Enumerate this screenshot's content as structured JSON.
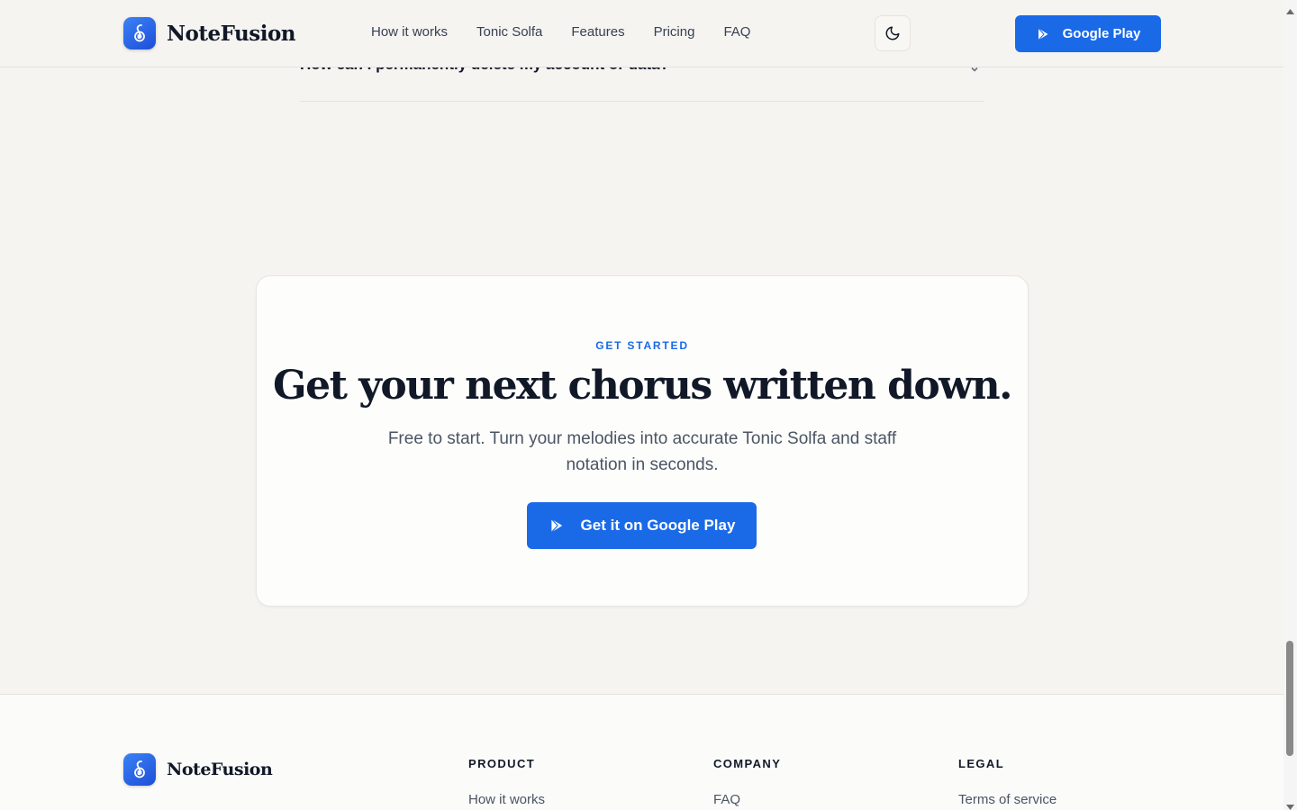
{
  "header": {
    "brand": "NoteFusion",
    "nav": [
      "How it works",
      "Tonic Solfa",
      "Features",
      "Pricing",
      "FAQ"
    ],
    "play_button": "Google Play",
    "theme_icon": "moon-icon"
  },
  "faq": {
    "question": "How can I permanently delete my account or data?"
  },
  "cta": {
    "eyebrow": "GET STARTED",
    "title": "Get your next chorus written down.",
    "subtitle": "Free to start. Turn your melodies into accurate Tonic Solfa and staff notation in seconds.",
    "button": "Get it on Google Play"
  },
  "footer": {
    "brand": "NoteFusion",
    "columns": [
      {
        "heading": "PRODUCT",
        "links": [
          "How it works"
        ]
      },
      {
        "heading": "COMPANY",
        "links": [
          "FAQ"
        ]
      },
      {
        "heading": "LEGAL",
        "links": [
          "Terms of service"
        ]
      }
    ]
  },
  "colors": {
    "accent": "#1a6ae8",
    "background": "#f5f4f1",
    "card": "#fdfdfc",
    "text": "#111827"
  }
}
